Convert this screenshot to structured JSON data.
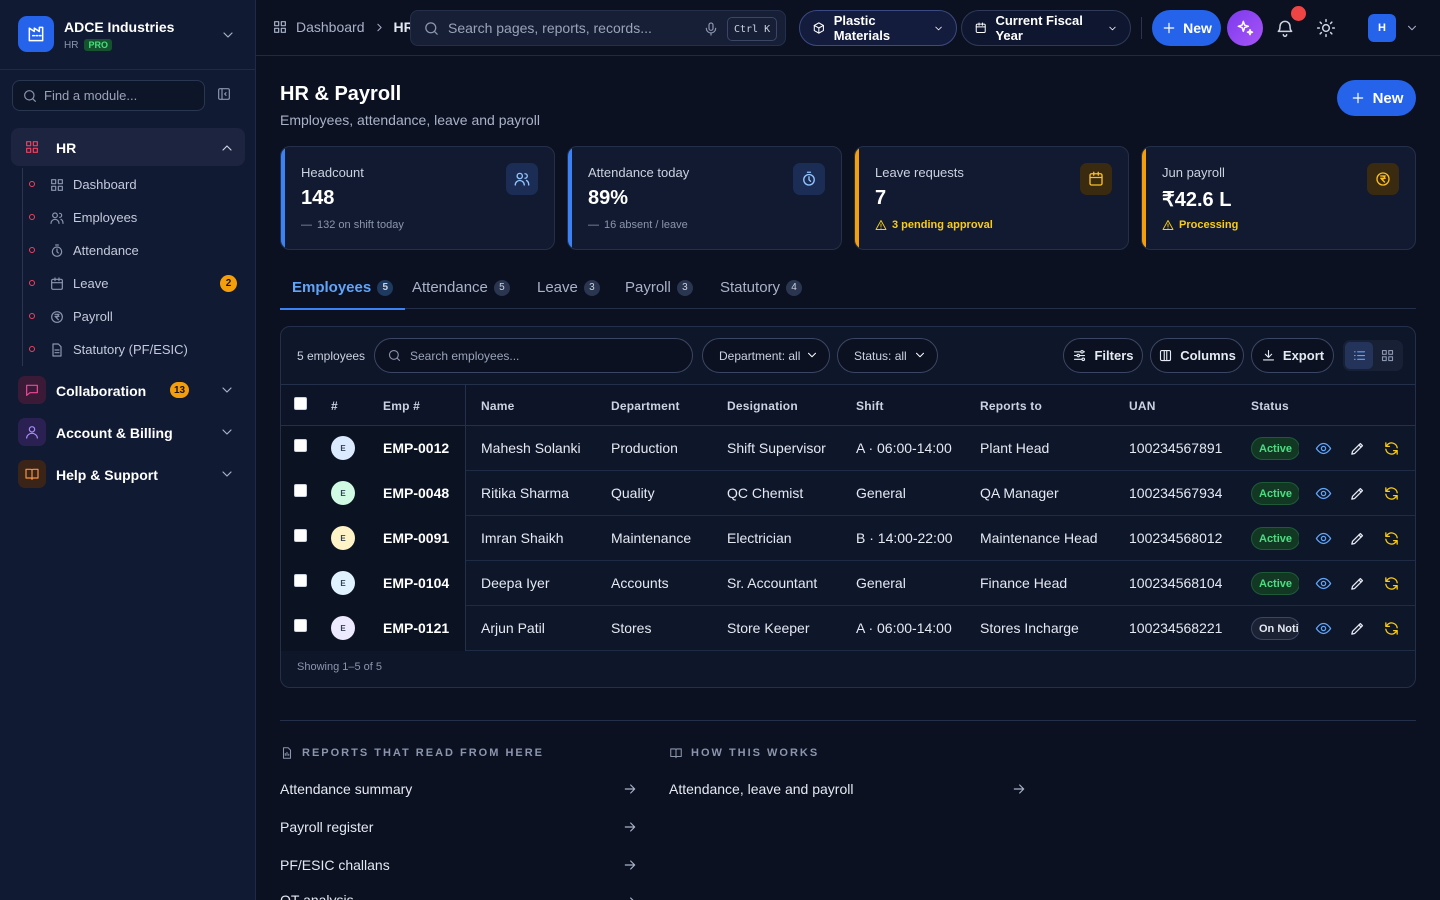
{
  "org": {
    "name": "ADCE Industries",
    "module": "HR",
    "plan": "PRO"
  },
  "sidebar": {
    "search_placeholder": "Find a module...",
    "active_group": {
      "label": "HR"
    },
    "sub_items": [
      {
        "label": "Dashboard",
        "icon": "grid-icon"
      },
      {
        "label": "Employees",
        "icon": "users-icon"
      },
      {
        "label": "Attendance",
        "icon": "timer-icon"
      },
      {
        "label": "Leave",
        "icon": "calendar-icon",
        "badge": "2"
      },
      {
        "label": "Payroll",
        "icon": "rupee-icon"
      },
      {
        "label": "Statutory (PF/ESIC)",
        "icon": "document-icon"
      }
    ],
    "groups": [
      {
        "label": "Collaboration",
        "badge": "13",
        "icon": "chat-icon",
        "color": "#ec4899"
      },
      {
        "label": "Account & Billing",
        "icon": "user-icon",
        "color": "#8b5cf6"
      },
      {
        "label": "Help & Support",
        "icon": "book-icon",
        "color": "#f97316"
      }
    ]
  },
  "topbar": {
    "breadcrumb": [
      "Dashboard",
      "HR"
    ],
    "search_placeholder": "Search pages, reports, records...",
    "shortcut": "Ctrl K",
    "business_unit": "Plastic Materials",
    "period": "Current Fiscal Year",
    "new_label": "New",
    "user_initial": "H"
  },
  "header": {
    "title": "HR & Payroll",
    "subtitle": "Employees, attendance, leave and payroll",
    "new_label": "New"
  },
  "kpis": [
    {
      "title": "Headcount",
      "value": "148",
      "sub": "132 on shift today",
      "accent": "#3b82f6",
      "icon": "users-icon",
      "warn": false
    },
    {
      "title": "Attendance today",
      "value": "89%",
      "sub": "16 absent / leave",
      "accent": "#3b82f6",
      "icon": "timer-icon",
      "warn": false
    },
    {
      "title": "Leave requests",
      "value": "7",
      "sub": "3 pending approval",
      "accent": "#f59e0b",
      "icon": "calendar-icon",
      "warn": true
    },
    {
      "title": "Jun payroll",
      "value": "₹42.6 L",
      "sub": "Processing",
      "accent": "#f59e0b",
      "icon": "rupee-icon",
      "warn": true
    }
  ],
  "tabs": [
    {
      "label": "Employees",
      "count": "5"
    },
    {
      "label": "Attendance",
      "count": "5"
    },
    {
      "label": "Leave",
      "count": "3"
    },
    {
      "label": "Payroll",
      "count": "3"
    },
    {
      "label": "Statutory",
      "count": "4"
    }
  ],
  "table": {
    "count_label": "5 employees",
    "search_placeholder": "Search employees...",
    "department_filter": "Department: all",
    "status_filter": "Status: all",
    "filters_label": "Filters",
    "columns_label": "Columns",
    "export_label": "Export",
    "headers": [
      "#",
      "Emp #",
      "Name",
      "Department",
      "Designation",
      "Shift",
      "Reports to",
      "UAN",
      "Status"
    ],
    "rows": [
      {
        "initial": "E",
        "avatar_color": "#dbeafe",
        "emp": "EMP-0012",
        "name": "Mahesh Solanki",
        "dept": "Production",
        "designation": "Shift Supervisor",
        "shift": "A · 06:00-14:00",
        "reports_to": "Plant Head",
        "uan": "100234567891",
        "status": "Active",
        "status_type": "active"
      },
      {
        "initial": "E",
        "avatar_color": "#d1fae5",
        "emp": "EMP-0048",
        "name": "Ritika Sharma",
        "dept": "Quality",
        "designation": "QC Chemist",
        "shift": "General",
        "reports_to": "QA Manager",
        "uan": "100234567934",
        "status": "Active",
        "status_type": "active"
      },
      {
        "initial": "E",
        "avatar_color": "#fef3c7",
        "emp": "EMP-0091",
        "name": "Imran Shaikh",
        "dept": "Maintenance",
        "designation": "Electrician",
        "shift": "B · 14:00-22:00",
        "reports_to": "Maintenance Head",
        "uan": "100234568012",
        "status": "Active",
        "status_type": "active"
      },
      {
        "initial": "E",
        "avatar_color": "#e0f2fe",
        "emp": "EMP-0104",
        "name": "Deepa Iyer",
        "dept": "Accounts",
        "designation": "Sr. Accountant",
        "shift": "General",
        "reports_to": "Finance Head",
        "uan": "100234568104",
        "status": "Active",
        "status_type": "active"
      },
      {
        "initial": "E",
        "avatar_color": "#ede9fe",
        "emp": "EMP-0121",
        "name": "Arjun Patil",
        "dept": "Stores",
        "designation": "Store Keeper",
        "shift": "A · 06:00-14:00",
        "reports_to": "Stores Incharge",
        "uan": "100234568221",
        "status": "On Notice",
        "status_type": "notice"
      }
    ],
    "footer": "Showing 1–5 of 5"
  },
  "reports": {
    "heading": "REPORTS THAT READ FROM HERE",
    "links": [
      "Attendance summary",
      "Payroll register",
      "PF/ESIC challans",
      "OT analysis"
    ]
  },
  "how": {
    "heading": "HOW THIS WORKS",
    "links": [
      "Attendance, leave and payroll"
    ]
  }
}
